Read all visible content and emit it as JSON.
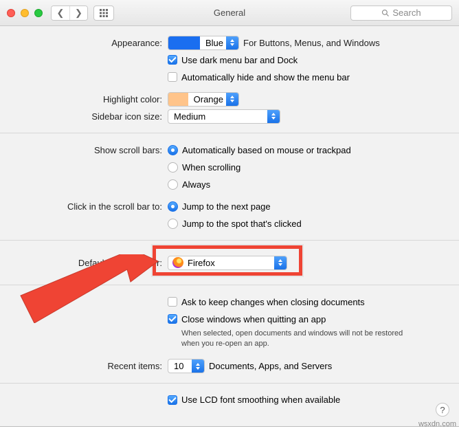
{
  "window": {
    "title": "General",
    "search_placeholder": "Search"
  },
  "appearance": {
    "label": "Appearance:",
    "value": "Blue",
    "hint": "For Buttons, Menus, and Windows",
    "dark_menu": {
      "checked": true,
      "label": "Use dark menu bar and Dock"
    },
    "auto_hide": {
      "checked": false,
      "label": "Automatically hide and show the menu bar"
    }
  },
  "highlight": {
    "label": "Highlight color:",
    "value": "Orange"
  },
  "sidebar_size": {
    "label": "Sidebar icon size:",
    "value": "Medium"
  },
  "scroll": {
    "label": "Show scroll bars:",
    "options": {
      "auto": {
        "selected": true,
        "label": "Automatically based on mouse or trackpad"
      },
      "scrolling": {
        "selected": false,
        "label": "When scrolling"
      },
      "always": {
        "selected": false,
        "label": "Always"
      }
    }
  },
  "click_scroll": {
    "label": "Click in the scroll bar to:",
    "options": {
      "next": {
        "selected": true,
        "label": "Jump to the next page"
      },
      "spot": {
        "selected": false,
        "label": "Jump to the spot that's clicked"
      }
    }
  },
  "browser": {
    "label": "Default web browser:",
    "value": "Firefox"
  },
  "ask_keep": {
    "checked": false,
    "label": "Ask to keep changes when closing documents"
  },
  "close_windows": {
    "checked": true,
    "label": "Close windows when quitting an app",
    "note": "When selected, open documents and windows will not be restored when you re-open an app."
  },
  "recent": {
    "label": "Recent items:",
    "value": "10",
    "suffix": "Documents, Apps, and Servers"
  },
  "lcd": {
    "checked": true,
    "label": "Use LCD font smoothing when available"
  },
  "help": "?",
  "site": "wsxdn.com"
}
